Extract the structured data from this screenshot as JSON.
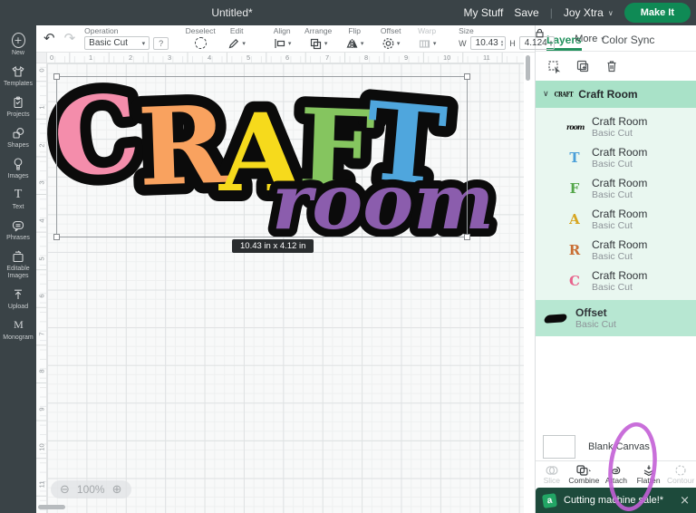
{
  "topbar": {
    "title": "Untitled*",
    "my_stuff": "My Stuff",
    "save": "Save",
    "machine": "Joy Xtra",
    "make_it": "Make It"
  },
  "icons": {
    "caret": "▾",
    "chevron_down": "∨",
    "undo": "↶",
    "redo": "↷",
    "zoom_out": "⊖",
    "zoom_in": "⊕",
    "close": "×",
    "help": "?",
    "stepper_up": "▴",
    "stepper_down": "▾",
    "pipe": "|",
    "access": "a",
    "text_tool": "T",
    "monogram": "M"
  },
  "toolbar": {
    "operation_label": "Operation",
    "operation_value": "Basic Cut",
    "deselect": "Deselect",
    "edit": "Edit",
    "align": "Align",
    "arrange": "Arrange",
    "flip": "Flip",
    "offset": "Offset",
    "warp": "Warp",
    "size_label": "Size",
    "w_label": "W",
    "w_value": "10.43",
    "h_label": "H",
    "h_value": "4.124",
    "more": "More"
  },
  "sidebar": {
    "items": [
      {
        "label": "New"
      },
      {
        "label": "Templates"
      },
      {
        "label": "Projects"
      },
      {
        "label": "Shapes"
      },
      {
        "label": "Images"
      },
      {
        "label": "Text"
      },
      {
        "label": "Phrases"
      },
      {
        "label": "Editable Images"
      },
      {
        "label": "Upload"
      },
      {
        "label": "Monogram"
      }
    ]
  },
  "canvas": {
    "ruler_h": [
      "0",
      "1",
      "2",
      "3",
      "4",
      "5",
      "6",
      "7",
      "8",
      "9",
      "10",
      "11"
    ],
    "ruler_v": [
      "0",
      "1",
      "2",
      "3",
      "4",
      "5",
      "6",
      "7",
      "8",
      "9",
      "10",
      "11"
    ],
    "zoom_value": "100%",
    "size_badge": "10.43 in x 4.12 in"
  },
  "design": {
    "outline_color": "#0b0b0b",
    "letters": [
      {
        "ch": "C",
        "color": "#f48dab"
      },
      {
        "ch": "R",
        "color": "#f9a25f"
      },
      {
        "ch": "A",
        "color": "#f6da1c"
      },
      {
        "ch": "F",
        "color": "#85c55f"
      },
      {
        "ch": "T",
        "color": "#4fa6dd"
      }
    ],
    "script": {
      "text": "room",
      "color": "#8b5dad"
    }
  },
  "layers_panel": {
    "tab_layers": "Layers",
    "tab_color_sync": "Color Sync",
    "group_title": "Craft Room",
    "group_thumb": "CRAFT",
    "children": [
      {
        "title": "Craft Room",
        "subtitle": "Basic Cut",
        "glyph": "room",
        "color": "#111111"
      },
      {
        "title": "Craft Room",
        "subtitle": "Basic Cut",
        "glyph": "T",
        "color": "#4a9fd8"
      },
      {
        "title": "Craft Room",
        "subtitle": "Basic Cut",
        "glyph": "F",
        "color": "#53a649"
      },
      {
        "title": "Craft Room",
        "subtitle": "Basic Cut",
        "glyph": "A",
        "color": "#d7a51f"
      },
      {
        "title": "Craft Room",
        "subtitle": "Basic Cut",
        "glyph": "R",
        "color": "#c96f35"
      },
      {
        "title": "Craft Room",
        "subtitle": "Basic Cut",
        "glyph": "C",
        "color": "#e8638c"
      }
    ],
    "offset_layer": {
      "title": "Offset",
      "subtitle": "Basic Cut"
    },
    "blank_canvas": "Blank Canvas",
    "actions": [
      {
        "label": "Slice"
      },
      {
        "label": "Combine"
      },
      {
        "label": "Attach"
      },
      {
        "label": "Flatten"
      },
      {
        "label": "Contour"
      }
    ],
    "notification": {
      "text": "Cutting machine sale!*"
    }
  },
  "colors": {
    "brand_green": "#0f8a55",
    "active_tab_green": "#23925e",
    "group_header_mint": "#a9e2c8",
    "children_mint": "#e9f7f0",
    "selected_mint": "#b7e7d2",
    "notification_bg": "#1d4a3b",
    "annotation_purple": "#c35fd6",
    "chrome_dark": "#3a4347"
  }
}
